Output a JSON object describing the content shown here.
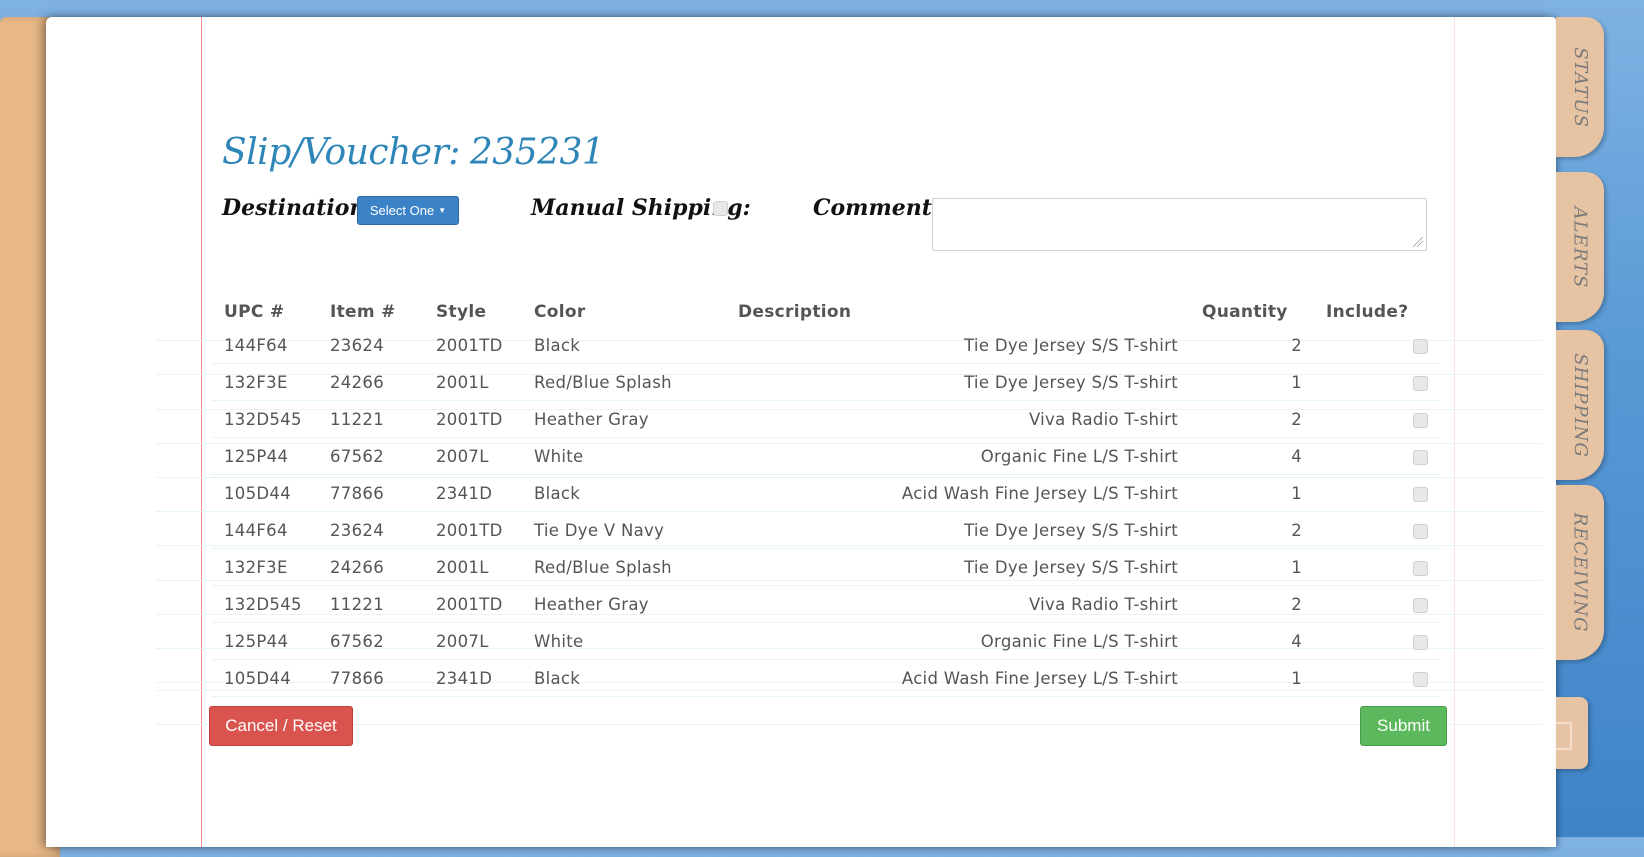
{
  "title": {
    "label": "Slip/Voucher:",
    "number": "235231"
  },
  "destination": {
    "label": "Destination:",
    "select_label": "Select One"
  },
  "manual_shipping": {
    "label": "Manual Shipping:",
    "checked": false
  },
  "comments": {
    "label": "Comments:",
    "value": ""
  },
  "table": {
    "headers": [
      "UPC #",
      "Item #",
      "Style",
      "Color",
      "Description",
      "Quantity",
      "Include?"
    ],
    "rows": [
      [
        "144F64",
        "23624",
        "2001TD",
        "Black",
        "Tie Dye Jersey S/S T-shirt",
        "2"
      ],
      [
        "132F3E",
        "24266",
        "2001L",
        "Red/Blue Splash",
        "Tie Dye Jersey S/S T-shirt",
        "1"
      ],
      [
        "132D545",
        "11221",
        "2001TD",
        "Heather Gray",
        "Viva Radio T-shirt",
        "2"
      ],
      [
        "125P44",
        "67562",
        "2007L",
        "White",
        "Organic Fine L/S T-shirt",
        "4"
      ],
      [
        "105D44",
        "77866",
        "2341D",
        "Black",
        "Acid Wash Fine Jersey L/S T-shirt",
        "1"
      ],
      [
        "144F64",
        "23624",
        "2001TD",
        "Tie Dye V Navy",
        "Tie Dye Jersey S/S T-shirt",
        "2"
      ],
      [
        "132F3E",
        "24266",
        "2001L",
        "Red/Blue Splash",
        "Tie Dye Jersey S/S T-shirt",
        "1"
      ],
      [
        "132D545",
        "11221",
        "2001TD",
        "Heather Gray",
        "Viva Radio T-shirt",
        "2"
      ],
      [
        "125P44",
        "67562",
        "2007L",
        "White",
        "Organic Fine L/S T-shirt",
        "4"
      ],
      [
        "105D44",
        "77866",
        "2341D",
        "Black",
        "Acid Wash Fine Jersey L/S T-shirt",
        "1"
      ]
    ]
  },
  "buttons": {
    "cancel": "Cancel / Reset",
    "submit": "Submit"
  },
  "tabs": [
    "STATUS",
    "ALERTS",
    "SHIPPING",
    "RECEIVING"
  ],
  "colors": {
    "title": "#2e86b8",
    "select": "#3b82c6",
    "cancel": "#d9534f",
    "submit": "#5cb85c",
    "tab": "#e6c3a2"
  }
}
